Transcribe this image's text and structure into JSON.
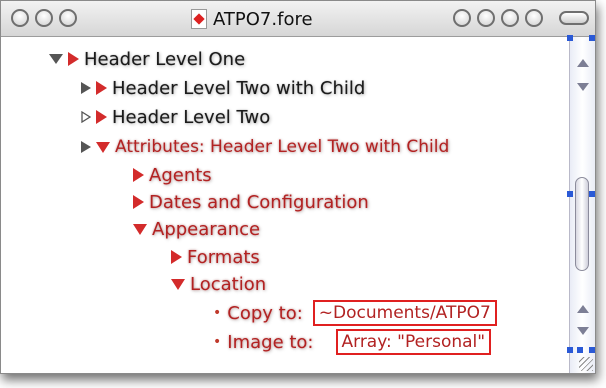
{
  "window": {
    "title": "ATPO7.fore",
    "icon": "document-icon"
  },
  "outline": {
    "rows": [
      {
        "label": "Header Level One",
        "icon": "disclosure-triangle-down",
        "marker": "red-triangle-right"
      },
      {
        "label": "Header Level Two with Child",
        "icon": "disclosure-triangle-right",
        "marker": "red-triangle-right"
      },
      {
        "label": "Header Level Two",
        "icon": "disclosure-triangle-hollow",
        "marker": "red-triangle-right"
      },
      {
        "label": "Attributes: Header Level Two with Child",
        "icon": "disclosure-triangle-right",
        "marker": "red-triangle-down"
      },
      {
        "label": "Agents",
        "marker": "red-triangle-right"
      },
      {
        "label": "Dates and Configuration",
        "marker": "red-triangle-right"
      },
      {
        "label": "Appearance",
        "marker": "red-triangle-down"
      },
      {
        "label": "Formats",
        "marker": "red-triangle-right"
      },
      {
        "label": "Location",
        "marker": "red-triangle-down"
      },
      {
        "label": "Copy to:",
        "value": "~Documents/ATPO7",
        "marker": "bullet"
      },
      {
        "label": "Image to:",
        "value": "Array: \"Personal\"",
        "marker": "bullet"
      }
    ]
  },
  "colors": {
    "accent_red": "#d32b2b",
    "text_red": "#b22222",
    "selection_handle": "#2a59d6"
  }
}
